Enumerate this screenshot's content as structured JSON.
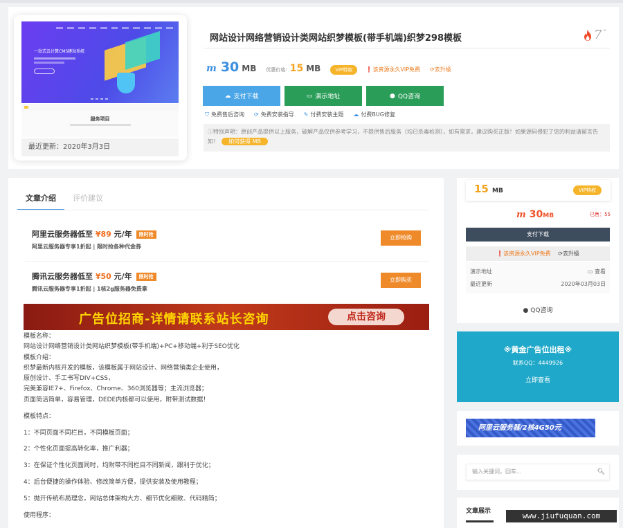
{
  "product": {
    "thumb_slogan": "一站式云计算CMS建站系统",
    "thumb_service": "服务项目",
    "updated": "最近更新：2020年3月3日",
    "title": "网站设计网络营销设计类网站织梦模板(带手机端)织梦298模板",
    "heat": "7",
    "heat_deg": "°",
    "price": "30",
    "price_unit": "MB",
    "vip_label": "优惠价格:",
    "vip_price": "15",
    "vip_unit": "MB",
    "vip_badge": "VIP特权",
    "free_note": "该资源永久VIP免费",
    "upgrade": "去升级",
    "buttons": {
      "download": "支付下载",
      "demo": "演示地址",
      "qq": "QQ咨询"
    },
    "features": [
      "免费售后咨询",
      "免费安装指导",
      "付费安装主题",
      "付费BUG修复"
    ],
    "notice": "特别声明：原创产品提供以上服务，破解产品仅供参考学习，不提供售后服务（均已杀毒检测），如有需求，建议购买正版！如果源码侵犯了您的利益请留言告知！",
    "notice_button": "如何获得 MB"
  },
  "article": {
    "tabs": [
      "文章介绍",
      "评价建议"
    ],
    "ads": [
      {
        "prefix": "阿里云服务器低至 ",
        "price": "¥89",
        "suffix": " 元/年",
        "tag": "限时抢",
        "sub": "阿里云服务器专享1折起 | 限时抢各种代金券",
        "button": "立即抢购"
      },
      {
        "prefix": "腾讯云服务器低至 ",
        "price": "¥50",
        "suffix": " 元/年",
        "tag": "限时抢",
        "sub": "腾讯云服务器专享1折起 | 1核2g服务器免费拿",
        "button": "立即购买"
      }
    ],
    "banner_text": "广告位招商-详情请联系站长咨询",
    "banner_button": "点击咨询",
    "lines": [
      "模板名称：",
      "网站设计网络营销设计类网站织梦模板(带手机端)+PC+移动端+利于SEO优化",
      "模板介绍：",
      "织梦最新内核开发的模板，该模板属于网站设计、网络营销类企业使用，",
      "原创设计、手工书写DIV+CSS，",
      "完美兼容IE7+、Firefox、Chrome、360浏览器等；主流浏览器；",
      "页面简洁简单，容易管理，DEDE内核都可以使用，附带测试数据！",
      "",
      "模板特点：",
      "",
      "1：不同页面不同栏目，不同模板页面；",
      "",
      "2：个性化页面提高转化率，推广利器；",
      "",
      "3：在保证个性化页面同时，均附带不同栏目不同新闻，跟利于优化；",
      "",
      "4：后台便捷的操作体验、修改简单方便，提供安装及使用教程；",
      "",
      "5：抛开传统布局理念，网站总体架构大方、细节优化细致、代码精简；",
      "",
      " 使用程序："
    ]
  },
  "sidebar": {
    "vip_price": "15",
    "vip_unit": "MB",
    "vip_badge": "VIP特权",
    "price": "30",
    "price_unit": "MB",
    "sales": "已售：55",
    "download": "支付下载",
    "free_note": "该资源永久VIP免费",
    "upgrade": "去升级",
    "info": [
      {
        "label": "演示地址",
        "value": "查看"
      },
      {
        "label": "最近更新",
        "value": "2020年03月03日"
      }
    ],
    "qq": "QQ咨询",
    "gold": {
      "title": "※黄金广告位出租※",
      "qq": "联系QQ：4449926",
      "button": "立即查看"
    },
    "ali_banner": "阿里云服务器/2核4G50元",
    "search_placeholder": "输入关键词，回车...",
    "posts_title": "文章展示"
  },
  "watermark": "www.jiufuquan.com",
  "colors": {
    "accent": "#3a8fe0",
    "vip": "#f5b42a",
    "green": "#2a9d58",
    "orange": "#ef8a2a"
  }
}
